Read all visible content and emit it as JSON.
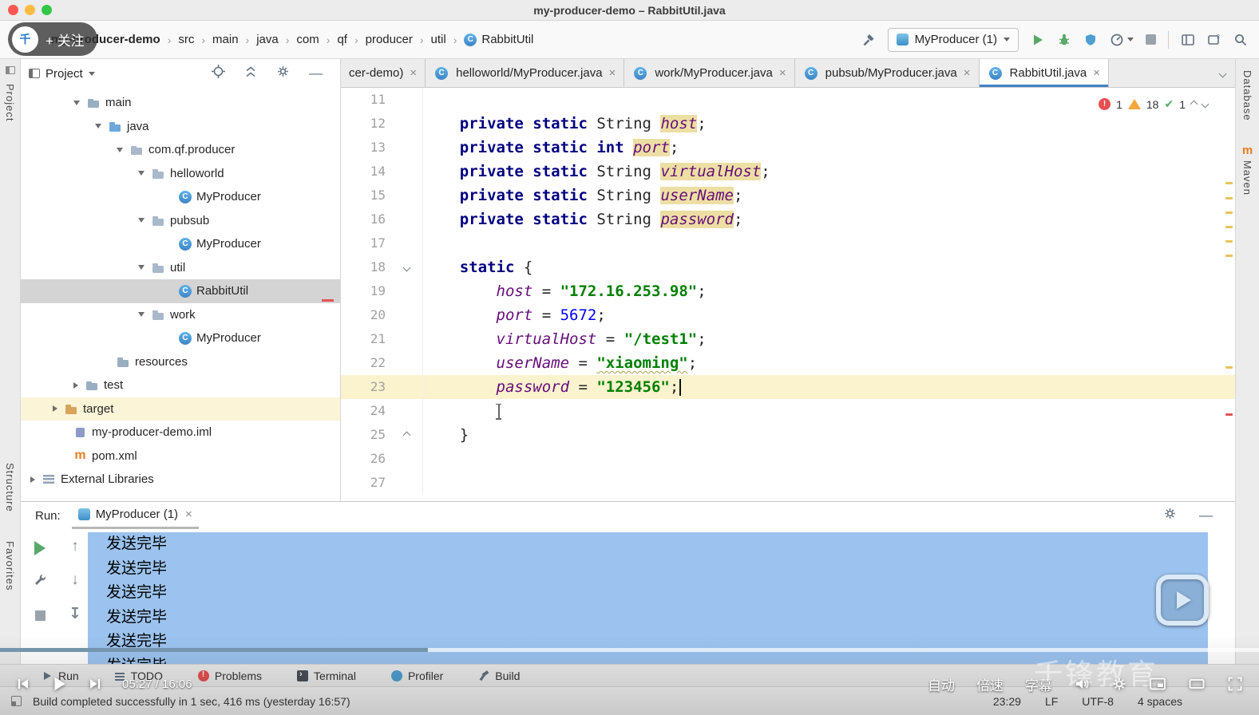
{
  "titlebar": {
    "title": "my-producer-demo – RabbitUtil.java"
  },
  "navbar": {
    "breadcrumbs": [
      "my-producer-demo",
      "src",
      "main",
      "java",
      "com",
      "qf",
      "producer",
      "util",
      "RabbitUtil"
    ],
    "run_config": "MyProducer (1)"
  },
  "stripes": {
    "left_top": "Project",
    "left_middle": "Structure",
    "left_bottom": "Favorites",
    "right_top": "Database",
    "right_middle": "Maven"
  },
  "project": {
    "header": "Project",
    "tree": [
      {
        "label": "main",
        "pad": 62,
        "chevron": "down",
        "icon": "folder"
      },
      {
        "label": "java",
        "pad": 89,
        "chevron": "down",
        "icon": "folder-src"
      },
      {
        "label": "com.qf.producer",
        "pad": 116,
        "chevron": "down",
        "icon": "package"
      },
      {
        "label": "helloworld",
        "pad": 143,
        "chevron": "down",
        "icon": "package"
      },
      {
        "label": "MyProducer",
        "pad": 198,
        "chevron": "",
        "icon": "class"
      },
      {
        "label": "pubsub",
        "pad": 143,
        "chevron": "down",
        "icon": "package"
      },
      {
        "label": "MyProducer",
        "pad": 198,
        "chevron": "",
        "icon": "class"
      },
      {
        "label": "util",
        "pad": 143,
        "chevron": "down",
        "icon": "package"
      },
      {
        "label": "RabbitUtil",
        "pad": 198,
        "chevron": "",
        "icon": "class",
        "selected": true
      },
      {
        "label": "work",
        "pad": 143,
        "chevron": "down",
        "icon": "package"
      },
      {
        "label": "MyProducer",
        "pad": 198,
        "chevron": "",
        "icon": "class"
      },
      {
        "label": "resources",
        "pad": 120,
        "chevron": "",
        "icon": "folder"
      },
      {
        "label": "test",
        "pad": 62,
        "chevron": "right",
        "icon": "folder"
      },
      {
        "label": "target",
        "pad": 36,
        "chevron": "right",
        "icon": "folder-excl",
        "rowhl": true
      },
      {
        "label": "my-producer-demo.iml",
        "pad": 66,
        "chevron": "",
        "icon": "iml"
      },
      {
        "label": "pom.xml",
        "pad": 66,
        "chevron": "",
        "icon": "maven"
      },
      {
        "label": "External Libraries",
        "pad": 8,
        "chevron": "right",
        "icon": "lib"
      }
    ]
  },
  "editor": {
    "tabs": [
      {
        "label": "cer-demo)",
        "icon": false,
        "active": false
      },
      {
        "label": "helloworld/MyProducer.java",
        "icon": true,
        "active": false
      },
      {
        "label": "work/MyProducer.java",
        "icon": true,
        "active": false
      },
      {
        "label": "pubsub/MyProducer.java",
        "icon": true,
        "active": false
      },
      {
        "label": "RabbitUtil.java",
        "icon": true,
        "active": true
      }
    ],
    "inspections": {
      "errors": "1",
      "warnings": "18",
      "passed": "1"
    },
    "code": [
      {
        "n": "11",
        "segs": []
      },
      {
        "n": "12",
        "segs": [
          [
            "    ",
            ""
          ],
          [
            "private static ",
            "kw"
          ],
          [
            "String ",
            ""
          ],
          [
            "host",
            "field hl"
          ],
          [
            ";",
            ""
          ]
        ]
      },
      {
        "n": "13",
        "segs": [
          [
            "    ",
            ""
          ],
          [
            "private static int ",
            "kw"
          ],
          [
            "port",
            "field hl"
          ],
          [
            ";",
            ""
          ]
        ]
      },
      {
        "n": "14",
        "segs": [
          [
            "    ",
            ""
          ],
          [
            "private static ",
            "kw"
          ],
          [
            "String ",
            ""
          ],
          [
            "virtualHost",
            "field hl"
          ],
          [
            ";",
            ""
          ]
        ]
      },
      {
        "n": "15",
        "segs": [
          [
            "    ",
            ""
          ],
          [
            "private static ",
            "kw"
          ],
          [
            "String ",
            ""
          ],
          [
            "userName",
            "field hl"
          ],
          [
            ";",
            ""
          ]
        ]
      },
      {
        "n": "16",
        "segs": [
          [
            "    ",
            ""
          ],
          [
            "private static ",
            "kw"
          ],
          [
            "String ",
            ""
          ],
          [
            "password",
            "field hl"
          ],
          [
            ";",
            ""
          ]
        ]
      },
      {
        "n": "17",
        "segs": []
      },
      {
        "n": "18",
        "fold": "down",
        "segs": [
          [
            "    ",
            ""
          ],
          [
            "static",
            "kw"
          ],
          [
            " {",
            ""
          ]
        ]
      },
      {
        "n": "19",
        "segs": [
          [
            "        ",
            ""
          ],
          [
            "host",
            "field"
          ],
          [
            " = ",
            ""
          ],
          [
            "\"172.16.253.98\"",
            "str"
          ],
          [
            ";",
            ""
          ]
        ]
      },
      {
        "n": "20",
        "segs": [
          [
            "        ",
            ""
          ],
          [
            "port",
            "field"
          ],
          [
            " = ",
            ""
          ],
          [
            "5672",
            "num"
          ],
          [
            ";",
            ""
          ]
        ]
      },
      {
        "n": "21",
        "segs": [
          [
            "        ",
            ""
          ],
          [
            "virtualHost",
            "field"
          ],
          [
            " = ",
            ""
          ],
          [
            "\"/test1\"",
            "str"
          ],
          [
            ";",
            ""
          ]
        ]
      },
      {
        "n": "22",
        "segs": [
          [
            "        ",
            ""
          ],
          [
            "userName",
            "field"
          ],
          [
            " = ",
            ""
          ],
          [
            "\"xiaoming\"",
            "str typo"
          ],
          [
            ";",
            ""
          ]
        ]
      },
      {
        "n": "23",
        "current": true,
        "caret": true,
        "segs": [
          [
            "        ",
            ""
          ],
          [
            "password",
            "field"
          ],
          [
            " = ",
            ""
          ],
          [
            "\"123456\"",
            "str"
          ],
          [
            ";",
            ""
          ]
        ]
      },
      {
        "n": "24",
        "ibeam": true,
        "segs": [
          [
            "        ",
            ""
          ]
        ]
      },
      {
        "n": "25",
        "fold": "up",
        "segs": [
          [
            "    ",
            ""
          ],
          [
            "}",
            ""
          ]
        ]
      },
      {
        "n": "26",
        "segs": []
      },
      {
        "n": "27",
        "segs": []
      }
    ]
  },
  "run_panel": {
    "label": "Run:",
    "tab_label": "MyProducer (1)",
    "console": [
      "发送完毕",
      "发送完毕",
      "发送完毕",
      "发送完毕",
      "发送完毕",
      "发送完毕"
    ]
  },
  "bottom_tabs": [
    "Run",
    "TODO",
    "Problems",
    "Terminal",
    "Profiler",
    "Build"
  ],
  "statusbar": {
    "message": "Build completed successfully in 1 sec, 416 ms (yesterday 16:57)",
    "clock": "23:29",
    "line_sep": "LF",
    "encoding": "UTF-8",
    "indent": "4 spaces"
  },
  "overlay": {
    "follow_label": "+ 关注",
    "watermark": "千锋教育",
    "video_time": "05:27 / 16:06",
    "quality_label": "自动",
    "speed_label": "倍速",
    "subtitle_label": "字幕",
    "progress_percent": 34
  }
}
